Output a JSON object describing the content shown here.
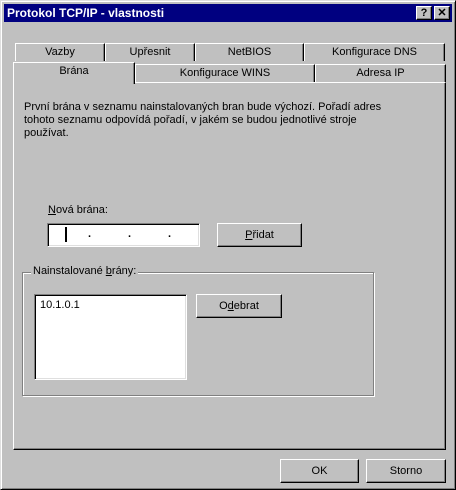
{
  "window": {
    "title": "Protokol TCP/IP - vlastnosti",
    "help_glyph": "?",
    "close_glyph": "✕"
  },
  "tabs_back": [
    {
      "label": "Vazby"
    },
    {
      "label": "Upřesnit"
    },
    {
      "label": "NetBIOS"
    },
    {
      "label": "Konfigurace DNS"
    }
  ],
  "tabs_front": [
    {
      "label": "Brána",
      "active": true
    },
    {
      "label": "Konfigurace WINS"
    },
    {
      "label": "Adresa IP"
    }
  ],
  "panel": {
    "description": "První brána v seznamu nainstalovaných bran bude výchozí. Pořadí adres tohoto seznamu odpovídá pořadí, v jakém se budou jednotlivé stroje používat.",
    "new_gateway": {
      "label_mnemonic": "N",
      "label_rest": "ová brána:",
      "value": "",
      "dots": [
        ".",
        ".",
        "."
      ]
    },
    "add_button": {
      "mnemonic": "P",
      "rest": "řidat"
    },
    "installed": {
      "label_prefix": "Nainstalované ",
      "label_mnemonic": "b",
      "label_rest": "rány:",
      "items": [
        "10.1.0.1"
      ]
    },
    "remove_button": {
      "prefix": "O",
      "mnemonic": "d",
      "rest": "ebrat"
    }
  },
  "footer": {
    "ok": "OK",
    "cancel": "Storno"
  },
  "colors": {
    "face": "#c0c0c0",
    "title_bar": "#000080",
    "highlight": "#ffffff",
    "shadow": "#808080"
  }
}
